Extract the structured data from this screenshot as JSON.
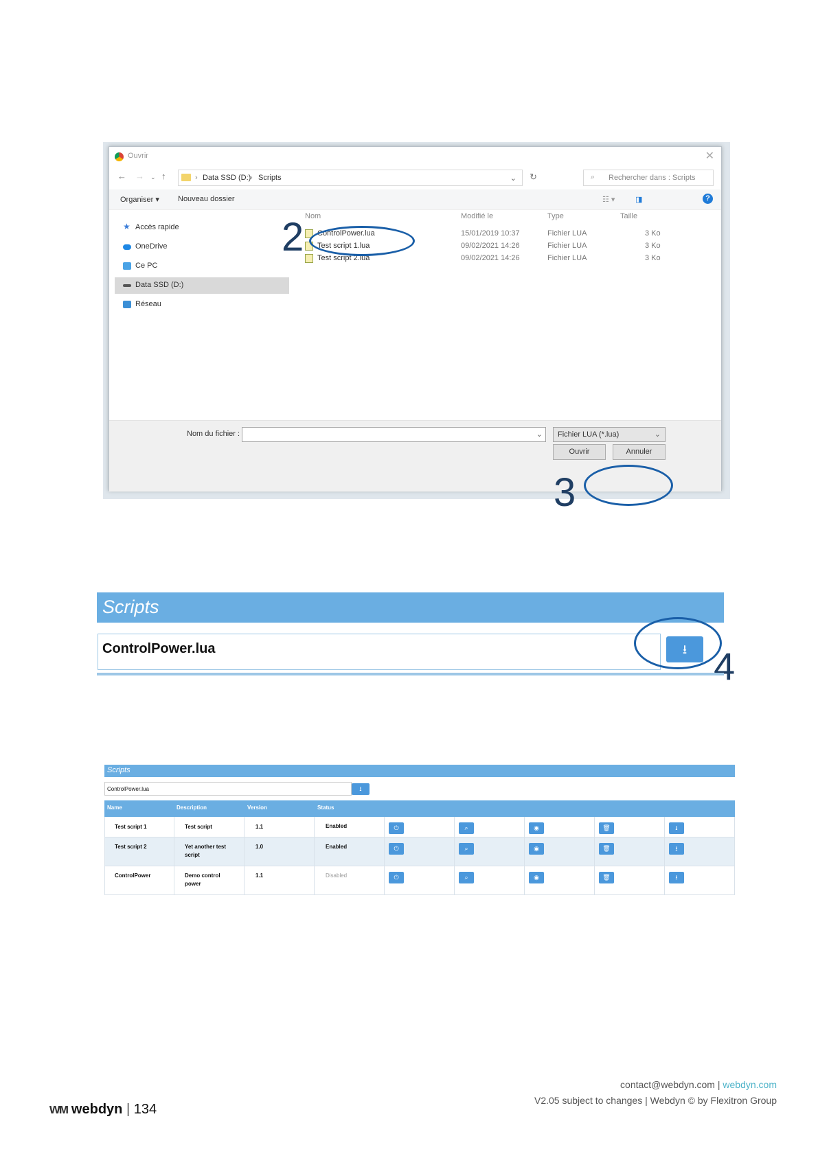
{
  "dialog": {
    "title": "Ouvrir",
    "path": [
      "Data SSD (D:)",
      "Scripts"
    ],
    "search_placeholder": "Rechercher dans : Scripts",
    "toolbar": {
      "organize": "Organiser ▾",
      "new_folder": "Nouveau dossier"
    },
    "sidebar": [
      "Accès rapide",
      "OneDrive",
      "Ce PC",
      "Data SSD (D:)",
      "Réseau"
    ],
    "columns": [
      "Nom",
      "Modifié le",
      "Type",
      "Taille"
    ],
    "files": [
      {
        "name": "ControlPower.lua",
        "modified": "15/01/2019 10:37",
        "type": "Fichier LUA",
        "size": "3 Ko"
      },
      {
        "name": "Test script 1.lua",
        "modified": "09/02/2021 14:26",
        "type": "Fichier LUA",
        "size": "3 Ko"
      },
      {
        "name": "Test script 2.lua",
        "modified": "09/02/2021 14:26",
        "type": "Fichier LUA",
        "size": "3 Ko"
      }
    ],
    "filename_label": "Nom du fichier :",
    "filter": "Fichier LUA (*.lua)",
    "open_button": "Ouvrir",
    "cancel_button": "Annuler"
  },
  "annotations": {
    "step2": "2",
    "step3": "3",
    "step4": "4"
  },
  "scripts_panel": {
    "title": "Scripts",
    "file_value": "ControlPower.lua"
  },
  "scripts_table": {
    "title": "Scripts",
    "file_value": "ControlPower.lua",
    "headers": [
      "Name",
      "Description",
      "Version",
      "Status"
    ],
    "rows": [
      {
        "name": "Test script 1",
        "description": "Test script",
        "version": "1.1",
        "status": "Enabled"
      },
      {
        "name": "Test script 2",
        "description": "Yet another test script",
        "version": "1.0",
        "status": "Enabled"
      },
      {
        "name": "ControlPower",
        "description": "Demo control power",
        "version": "1.1",
        "status": "Disabled"
      }
    ]
  },
  "footer": {
    "brand": "webdyn",
    "page_number": "134",
    "email": "contact@webdyn.com",
    "website": "webdyn.com",
    "version_line": "V2.05 subject to changes | Webdyn © by Flexitron Group"
  }
}
